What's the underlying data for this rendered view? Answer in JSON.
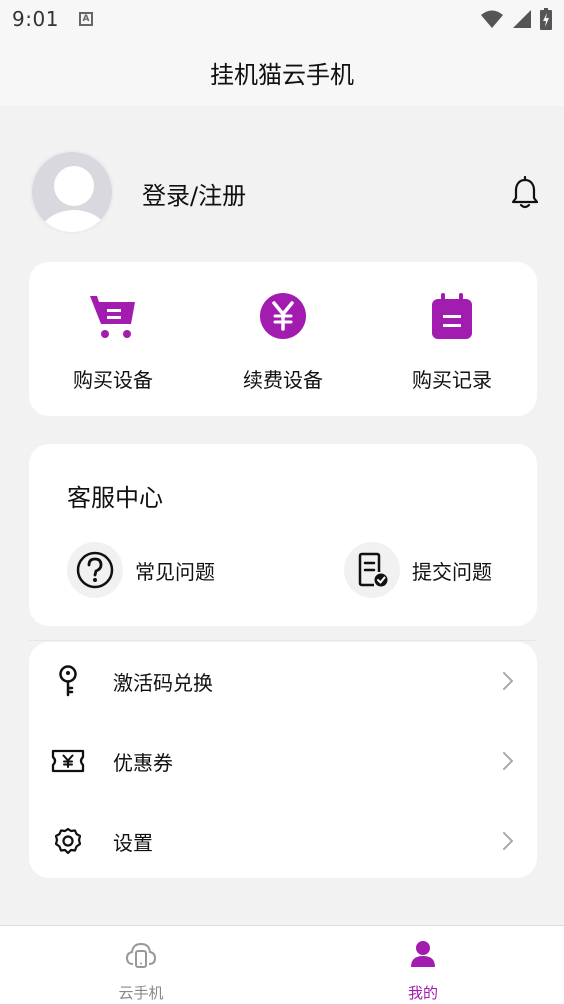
{
  "status_bar": {
    "time": "9:01",
    "notification_glyph": "A"
  },
  "header": {
    "title": "挂机猫云手机"
  },
  "profile": {
    "login_label": "登录/注册"
  },
  "quick_actions": [
    {
      "label": "购买设备",
      "icon": "cart-icon"
    },
    {
      "label": "续费设备",
      "icon": "yuan-icon"
    },
    {
      "label": "购买记录",
      "icon": "calendar-icon"
    }
  ],
  "service": {
    "title": "客服中心",
    "items": [
      {
        "label": "常见问题",
        "icon": "question-icon"
      },
      {
        "label": "提交问题",
        "icon": "document-check-icon"
      }
    ]
  },
  "menu": [
    {
      "label": "激活码兑换",
      "icon": "key-icon"
    },
    {
      "label": "优惠券",
      "icon": "coupon-icon"
    },
    {
      "label": "设置",
      "icon": "gear-icon"
    }
  ],
  "bottom_nav": [
    {
      "label": "云手机",
      "icon": "cloud-phone-icon",
      "active": false
    },
    {
      "label": "我的",
      "icon": "person-icon",
      "active": true
    }
  ],
  "colors": {
    "accent": "#a21caf",
    "inactive": "#888888",
    "background": "#f2f2f2",
    "card": "#ffffff"
  }
}
